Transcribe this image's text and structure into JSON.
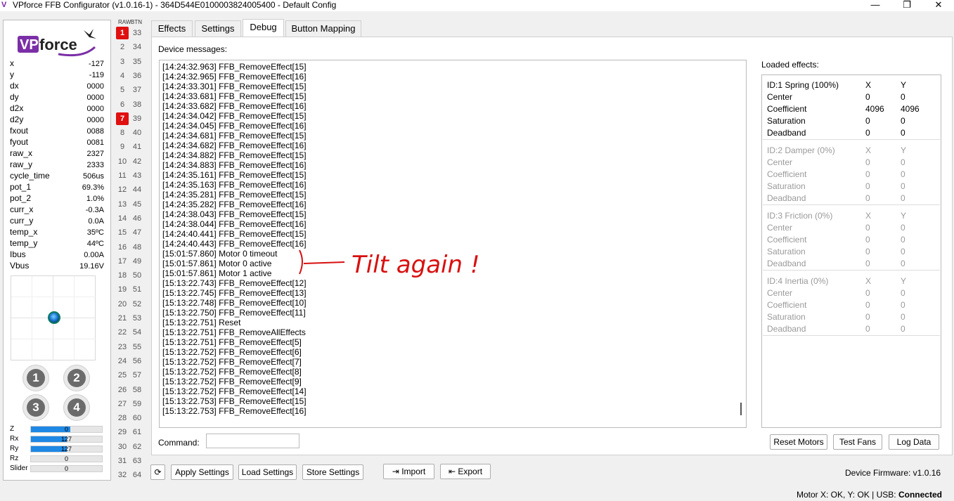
{
  "window": {
    "title": "VPforce FFB Configurator (v1.0.16-1) - 364D544E0100003824005400 - Default Config",
    "controls": {
      "minimize": "—",
      "maximize": "❐",
      "close": "✕"
    }
  },
  "left": {
    "logo_text": "VPforce",
    "axes": [
      {
        "label": "x",
        "value": "-127"
      },
      {
        "label": "y",
        "value": "-119"
      },
      {
        "label": "dx",
        "value": "0000"
      },
      {
        "label": "dy",
        "value": "0000"
      },
      {
        "label": "d2x",
        "value": "0000"
      },
      {
        "label": "d2y",
        "value": "0000"
      },
      {
        "label": "fxout",
        "value": "0088"
      },
      {
        "label": "fyout",
        "value": "0081"
      },
      {
        "label": "raw_x",
        "value": "2327"
      },
      {
        "label": "raw_y",
        "value": "2333"
      },
      {
        "label": "cycle_time",
        "value": "506us"
      },
      {
        "label": "pot_1",
        "value": "69.3%"
      },
      {
        "label": "pot_2",
        "value": "1.0%"
      },
      {
        "label": "curr_x",
        "value": "-0.3A"
      },
      {
        "label": "curr_y",
        "value": "0.0A"
      },
      {
        "label": "temp_x",
        "value": "35ºC"
      },
      {
        "label": "temp_y",
        "value": "44ºC"
      },
      {
        "label": "Ibus",
        "value": "0.00A"
      },
      {
        "label": "Vbus",
        "value": "19.16V"
      }
    ],
    "round_buttons": [
      "1",
      "2",
      "3",
      "4"
    ],
    "bars": [
      {
        "label": "Z",
        "value": "0",
        "fill": 0.55
      },
      {
        "label": "Rx",
        "value": "127",
        "fill": 0.5
      },
      {
        "label": "Ry",
        "value": "127",
        "fill": 0.5
      },
      {
        "label": "Rz",
        "value": "0",
        "fill": 0
      },
      {
        "label": "Slider",
        "value": "0",
        "fill": 0
      }
    ]
  },
  "buttons_column": {
    "header_raw": "RAW",
    "header_btn": "BTN",
    "left": [
      "1",
      "2",
      "3",
      "4",
      "5",
      "6",
      "7",
      "8",
      "9",
      "10",
      "11",
      "12",
      "13",
      "14",
      "15",
      "16",
      "17",
      "18",
      "19",
      "20",
      "21",
      "22",
      "23",
      "24",
      "25",
      "26",
      "27",
      "28",
      "29",
      "30",
      "31",
      "32"
    ],
    "right": [
      "33",
      "34",
      "35",
      "36",
      "37",
      "38",
      "39",
      "40",
      "41",
      "42",
      "43",
      "44",
      "45",
      "46",
      "47",
      "48",
      "49",
      "50",
      "51",
      "52",
      "53",
      "54",
      "55",
      "56",
      "57",
      "58",
      "59",
      "60",
      "61",
      "62",
      "63",
      "64"
    ],
    "active": [
      "1",
      "7"
    ]
  },
  "tabs": [
    "Effects",
    "Settings",
    "Debug",
    "Button Mapping"
  ],
  "active_tab": "Debug",
  "debug": {
    "device_messages_label": "Device messages:",
    "messages": [
      "[14:24:32.963] FFB_RemoveEffect[15]",
      "[14:24:32.965] FFB_RemoveEffect[16]",
      "[14:24:33.301] FFB_RemoveEffect[15]",
      "[14:24:33.681] FFB_RemoveEffect[15]",
      "[14:24:33.682] FFB_RemoveEffect[16]",
      "[14:24:34.042] FFB_RemoveEffect[15]",
      "[14:24:34.045] FFB_RemoveEffect[16]",
      "[14:24:34.681] FFB_RemoveEffect[15]",
      "[14:24:34.682] FFB_RemoveEffect[16]",
      "[14:24:34.882] FFB_RemoveEffect[15]",
      "[14:24:34.883] FFB_RemoveEffect[16]",
      "[14:24:35.161] FFB_RemoveEffect[15]",
      "[14:24:35.163] FFB_RemoveEffect[16]",
      "[14:24:35.281] FFB_RemoveEffect[15]",
      "[14:24:35.282] FFB_RemoveEffect[16]",
      "[14:24:38.043] FFB_RemoveEffect[15]",
      "[14:24:38.044] FFB_RemoveEffect[16]",
      "[14:24:40.441] FFB_RemoveEffect[15]",
      "[14:24:40.443] FFB_RemoveEffect[16]",
      "[15:01:57.860] Motor 0 timeout",
      "[15:01:57.861] Motor 0 active",
      "[15:01:57.861] Motor 1 active",
      "[15:13:22.743] FFB_RemoveEffect[12]",
      "[15:13:22.745] FFB_RemoveEffect[13]",
      "[15:13:22.748] FFB_RemoveEffect[10]",
      "[15:13:22.750] FFB_RemoveEffect[11]",
      "[15:13:22.751] Reset",
      "[15:13:22.751] FFB_RemoveAllEffects",
      "[15:13:22.751] FFB_RemoveEffect[5]",
      "[15:13:22.752] FFB_RemoveEffect[6]",
      "[15:13:22.752] FFB_RemoveEffect[7]",
      "[15:13:22.752] FFB_RemoveEffect[8]",
      "[15:13:22.752] FFB_RemoveEffect[9]",
      "[15:13:22.752] FFB_RemoveEffect[14]",
      "[15:13:22.753] FFB_RemoveEffect[15]",
      "[15:13:22.753] FFB_RemoveEffect[16]"
    ],
    "annotation": "Tilt again !",
    "loaded_effects_label": "Loaded effects:",
    "effects": [
      {
        "title": "ID:1 Spring (100%)",
        "active": true,
        "x_hdr": "X",
        "y_hdr": "Y",
        "rows": [
          [
            "Center",
            "0",
            "0"
          ],
          [
            "Coefficient",
            "4096",
            "4096"
          ],
          [
            "Saturation",
            "0",
            "0"
          ],
          [
            "Deadband",
            "0",
            "0"
          ]
        ]
      },
      {
        "title": "ID:2 Damper (0%)",
        "active": false,
        "x_hdr": "X",
        "y_hdr": "Y",
        "rows": [
          [
            "Center",
            "0",
            "0"
          ],
          [
            "Coefficient",
            "0",
            "0"
          ],
          [
            "Saturation",
            "0",
            "0"
          ],
          [
            "Deadband",
            "0",
            "0"
          ]
        ]
      },
      {
        "title": "ID:3 Friction (0%)",
        "active": false,
        "x_hdr": "X",
        "y_hdr": "Y",
        "rows": [
          [
            "Center",
            "0",
            "0"
          ],
          [
            "Coefficient",
            "0",
            "0"
          ],
          [
            "Saturation",
            "0",
            "0"
          ],
          [
            "Deadband",
            "0",
            "0"
          ]
        ]
      },
      {
        "title": "ID:4 Inertia (0%)",
        "active": false,
        "x_hdr": "X",
        "y_hdr": "Y",
        "rows": [
          [
            "Center",
            "0",
            "0"
          ],
          [
            "Coefficient",
            "0",
            "0"
          ],
          [
            "Saturation",
            "0",
            "0"
          ],
          [
            "Deadband",
            "0",
            "0"
          ]
        ]
      }
    ],
    "command_label": "Command:",
    "command_value": "",
    "reset_motors": "Reset Motors",
    "test_fans": "Test Fans",
    "log_data": "Log Data"
  },
  "bottom": {
    "refresh_icon": "⟳",
    "apply_settings": "Apply Settings",
    "load_settings": "Load Settings",
    "store_settings": "Store Settings",
    "import": "Import",
    "export": "Export",
    "firmware": "Device Firmware:  v1.0.16"
  },
  "status": {
    "motor": "Motor X: OK, Y: OK | USB: ",
    "usb": "Connected"
  }
}
